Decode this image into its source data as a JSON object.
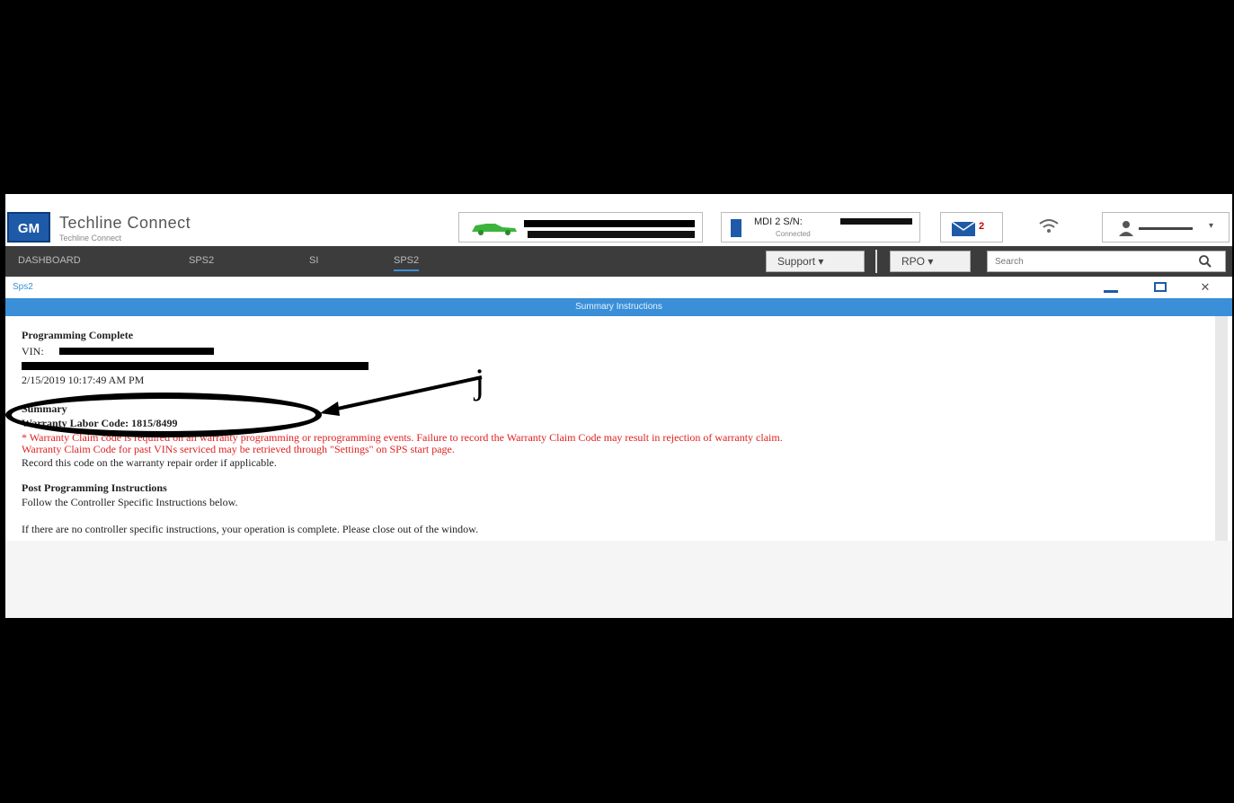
{
  "app": {
    "logo": "GM",
    "title": "Techline Connect",
    "subtitle": "Techline Connect"
  },
  "header": {
    "device_label": "MDI 2 S/N:",
    "device_sub": "Connected",
    "mail_count": "2"
  },
  "nav": {
    "tabs": [
      "DASHBOARD",
      "SPS2",
      "SI",
      "SPS2"
    ],
    "active_tab_index": 3,
    "support_label": "Support",
    "rpo_label": "RPO",
    "search_placeholder": "Search"
  },
  "window": {
    "label": "Sps2",
    "title": "Summary Instructions"
  },
  "content": {
    "programming_complete": "Programming Complete",
    "vin_label": "VIN: ",
    "timestamp": "2/15/2019 10:17:49 AM PM",
    "summary_heading": "Summary",
    "warranty_code": "Warranty Labor Code: 1815/8499",
    "red_line1": "* Warranty Claim code is required on all warranty programming or reprogramming events. Failure to record the Warranty Claim Code may result in rejection of warranty claim.",
    "red_line2": "Warranty Claim Code for past VINs serviced may be retrieved through \"Settings\" on SPS start page.",
    "record_note": "Record this code on the warranty repair order if applicable.",
    "post_heading": "Post Programming Instructions",
    "post_text": "Follow the Controller Specific Instructions below.",
    "footer_text": "If there are no controller specific instructions, your operation is complete. Please close out of the window."
  },
  "annotation": {
    "callout": "j"
  },
  "colors": {
    "accent_blue": "#3a8fd8",
    "nav_dark": "#3c3c3c",
    "warning_red": "#e02020",
    "car_green": "#3cb43c"
  },
  "icons": [
    "car-icon",
    "device-icon",
    "mail-icon",
    "wifi-icon",
    "user-icon",
    "search-icon",
    "minimize-icon",
    "maximize-icon",
    "close-icon"
  ]
}
